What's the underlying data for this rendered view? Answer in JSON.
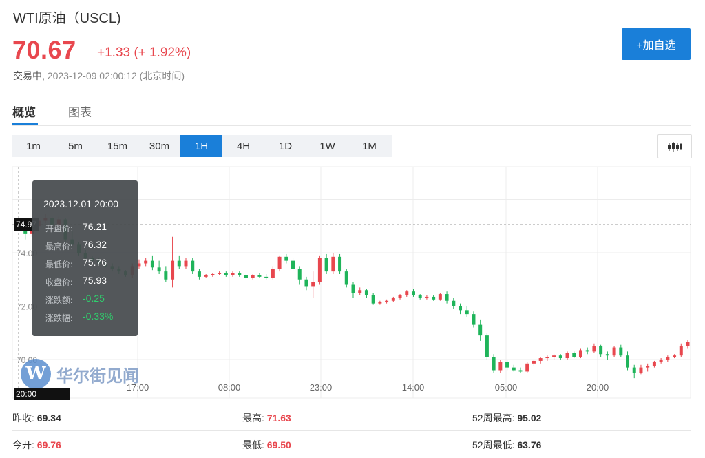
{
  "header": {
    "title": "WTI原油（USCL)",
    "price": "70.67",
    "change": "+1.33 (+ 1.92%)",
    "status": "交易中,",
    "timestamp": "2023-12-09 02:00:12 (北京时间)",
    "add_button": "+加自选"
  },
  "tabs": [
    {
      "label": "概览",
      "active": true
    },
    {
      "label": "图表",
      "active": false
    }
  ],
  "periods": [
    {
      "label": "1m"
    },
    {
      "label": "5m"
    },
    {
      "label": "15m"
    },
    {
      "label": "30m"
    },
    {
      "label": "1H",
      "active": true
    },
    {
      "label": "4H"
    },
    {
      "label": "1D"
    },
    {
      "label": "1W"
    },
    {
      "label": "1M"
    }
  ],
  "watermark": "华尔街见闻",
  "tooltip": {
    "date": "2023.12.01 20:00",
    "rows": [
      {
        "label": "开盘价:",
        "value": "76.21",
        "negative": false
      },
      {
        "label": "最高价:",
        "value": "76.32",
        "negative": false
      },
      {
        "label": "最低价:",
        "value": "75.76",
        "negative": false
      },
      {
        "label": "收盘价:",
        "value": "75.93",
        "negative": false
      },
      {
        "label": "涨跌额:",
        "value": "-0.25",
        "negative": true
      },
      {
        "label": "涨跌幅:",
        "value": "-0.33%",
        "negative": true
      }
    ]
  },
  "crosshair": {
    "price_label": "74.97",
    "time_label": "20:00"
  },
  "stats": [
    [
      {
        "label": "昨收:",
        "value": "69.34",
        "red": false
      },
      {
        "label": "最高:",
        "value": "71.63",
        "red": true
      },
      {
        "label": "52周最高:",
        "value": "95.02",
        "red": false
      }
    ],
    [
      {
        "label": "今开:",
        "value": "69.76",
        "red": true
      },
      {
        "label": "最低:",
        "value": "69.50",
        "red": true
      },
      {
        "label": "52周最低:",
        "value": "63.76",
        "red": false
      }
    ]
  ],
  "colors": {
    "up": "#e8474e",
    "down": "#1fb45a",
    "accent": "#1a7fd9"
  },
  "chart_data": {
    "type": "candlestick",
    "y_ticks": [
      "74.00",
      "72.00",
      "70.00"
    ],
    "x_ticks": [
      "17:00",
      "08:00",
      "23:00",
      "14:00",
      "05:00",
      "20:00"
    ],
    "ylim": [
      69.2,
      76.0
    ],
    "candles": [
      [
        74.97,
        75.15,
        74.85,
        74.95
      ],
      [
        74.95,
        75.05,
        74.5,
        74.7
      ],
      [
        74.7,
        75.1,
        74.6,
        75.0
      ],
      [
        75.0,
        75.3,
        74.9,
        75.2
      ],
      [
        75.2,
        75.45,
        75.1,
        75.3
      ],
      [
        75.3,
        75.35,
        74.95,
        75.05
      ],
      [
        75.05,
        75.35,
        75.0,
        75.25
      ],
      [
        75.25,
        75.3,
        74.4,
        74.5
      ],
      [
        74.5,
        74.8,
        74.2,
        74.3
      ],
      [
        74.3,
        74.4,
        73.9,
        74.0
      ],
      [
        74.0,
        74.1,
        73.7,
        73.8
      ],
      [
        73.8,
        73.9,
        73.6,
        73.7
      ],
      [
        73.7,
        73.8,
        73.55,
        73.6
      ],
      [
        73.6,
        73.7,
        73.45,
        73.5
      ],
      [
        73.5,
        73.6,
        73.3,
        73.4
      ],
      [
        73.4,
        73.5,
        73.2,
        73.3
      ],
      [
        73.3,
        73.35,
        73.1,
        73.15
      ],
      [
        73.15,
        73.6,
        73.05,
        73.5
      ],
      [
        73.5,
        73.75,
        73.4,
        73.6
      ],
      [
        73.6,
        73.8,
        73.5,
        73.7
      ],
      [
        73.7,
        73.9,
        73.35,
        73.45
      ],
      [
        73.45,
        73.7,
        73.2,
        73.3
      ],
      [
        73.3,
        73.5,
        72.9,
        73.0
      ],
      [
        73.0,
        74.6,
        72.7,
        73.7
      ],
      [
        73.7,
        73.9,
        73.4,
        73.5
      ],
      [
        73.5,
        73.8,
        73.4,
        73.7
      ],
      [
        73.7,
        73.8,
        73.2,
        73.3
      ],
      [
        73.3,
        73.4,
        73.0,
        73.1
      ],
      [
        73.1,
        73.2,
        73.05,
        73.15
      ],
      [
        73.15,
        73.25,
        73.1,
        73.2
      ],
      [
        73.2,
        73.3,
        73.15,
        73.25
      ],
      [
        73.25,
        73.3,
        73.1,
        73.15
      ],
      [
        73.15,
        73.3,
        73.1,
        73.25
      ],
      [
        73.25,
        73.3,
        73.1,
        73.15
      ],
      [
        73.15,
        73.2,
        73.0,
        73.05
      ],
      [
        73.05,
        73.2,
        73.0,
        73.15
      ],
      [
        73.15,
        73.25,
        73.05,
        73.1
      ],
      [
        73.1,
        73.2,
        73.0,
        73.05
      ],
      [
        73.05,
        73.5,
        73.0,
        73.4
      ],
      [
        73.4,
        73.9,
        73.3,
        73.85
      ],
      [
        73.85,
        73.95,
        73.6,
        73.7
      ],
      [
        73.7,
        73.8,
        73.3,
        73.4
      ],
      [
        73.4,
        73.5,
        72.8,
        73.0
      ],
      [
        73.0,
        73.1,
        72.6,
        72.75
      ],
      [
        72.75,
        73.3,
        72.3,
        72.9
      ],
      [
        72.9,
        73.9,
        72.8,
        73.8
      ],
      [
        73.8,
        73.95,
        73.2,
        73.3
      ],
      [
        73.3,
        74.0,
        73.2,
        73.85
      ],
      [
        73.85,
        73.95,
        73.2,
        73.3
      ],
      [
        73.3,
        73.4,
        72.7,
        72.8
      ],
      [
        72.8,
        72.9,
        72.3,
        72.5
      ],
      [
        72.5,
        72.7,
        72.4,
        72.6
      ],
      [
        72.6,
        72.65,
        72.3,
        72.4
      ],
      [
        72.4,
        72.5,
        72.05,
        72.1
      ],
      [
        72.1,
        72.2,
        72.05,
        72.15
      ],
      [
        72.15,
        72.25,
        72.1,
        72.2
      ],
      [
        72.2,
        72.35,
        72.15,
        72.3
      ],
      [
        72.3,
        72.45,
        72.25,
        72.4
      ],
      [
        72.4,
        72.6,
        72.35,
        72.55
      ],
      [
        72.55,
        72.65,
        72.35,
        72.4
      ],
      [
        72.4,
        72.45,
        72.25,
        72.3
      ],
      [
        72.3,
        72.4,
        72.25,
        72.35
      ],
      [
        72.35,
        72.4,
        72.2,
        72.25
      ],
      [
        72.25,
        72.5,
        72.2,
        72.45
      ],
      [
        72.45,
        72.55,
        72.1,
        72.2
      ],
      [
        72.2,
        72.3,
        71.9,
        72.0
      ],
      [
        72.0,
        72.1,
        71.7,
        71.85
      ],
      [
        71.85,
        72.0,
        71.6,
        71.7
      ],
      [
        71.7,
        71.8,
        71.2,
        71.3
      ],
      [
        71.3,
        71.5,
        70.7,
        70.9
      ],
      [
        70.9,
        71.0,
        70.0,
        70.1
      ],
      [
        70.1,
        70.2,
        69.5,
        69.6
      ],
      [
        69.6,
        70.0,
        69.5,
        69.9
      ],
      [
        69.9,
        70.0,
        69.6,
        69.7
      ],
      [
        69.7,
        69.8,
        69.55,
        69.6
      ],
      [
        69.6,
        69.7,
        69.5,
        69.55
      ],
      [
        69.55,
        69.9,
        69.5,
        69.85
      ],
      [
        69.85,
        70.0,
        69.75,
        69.95
      ],
      [
        69.95,
        70.1,
        69.85,
        70.05
      ],
      [
        70.05,
        70.15,
        69.95,
        70.1
      ],
      [
        70.1,
        70.2,
        70.0,
        70.15
      ],
      [
        70.15,
        70.2,
        70.0,
        70.05
      ],
      [
        70.05,
        70.3,
        70.0,
        70.25
      ],
      [
        70.25,
        70.3,
        70.05,
        70.1
      ],
      [
        70.1,
        70.4,
        70.05,
        70.35
      ],
      [
        70.35,
        70.45,
        70.2,
        70.3
      ],
      [
        70.3,
        70.6,
        70.25,
        70.5
      ],
      [
        70.5,
        70.55,
        70.1,
        70.2
      ],
      [
        70.2,
        70.3,
        70.0,
        70.15
      ],
      [
        70.15,
        70.5,
        70.1,
        70.45
      ],
      [
        70.45,
        70.55,
        70.1,
        70.15
      ],
      [
        70.15,
        70.3,
        69.6,
        69.7
      ],
      [
        69.7,
        69.8,
        69.3,
        69.5
      ],
      [
        69.5,
        69.8,
        69.45,
        69.7
      ],
      [
        69.7,
        69.85,
        69.55,
        69.75
      ],
      [
        69.75,
        69.95,
        69.7,
        69.9
      ],
      [
        69.9,
        70.05,
        69.85,
        70.0
      ],
      [
        70.0,
        70.15,
        69.9,
        70.1
      ],
      [
        70.1,
        70.2,
        70.05,
        70.15
      ],
      [
        70.15,
        70.6,
        70.1,
        70.5
      ],
      [
        70.5,
        70.75,
        70.4,
        70.67
      ]
    ]
  }
}
